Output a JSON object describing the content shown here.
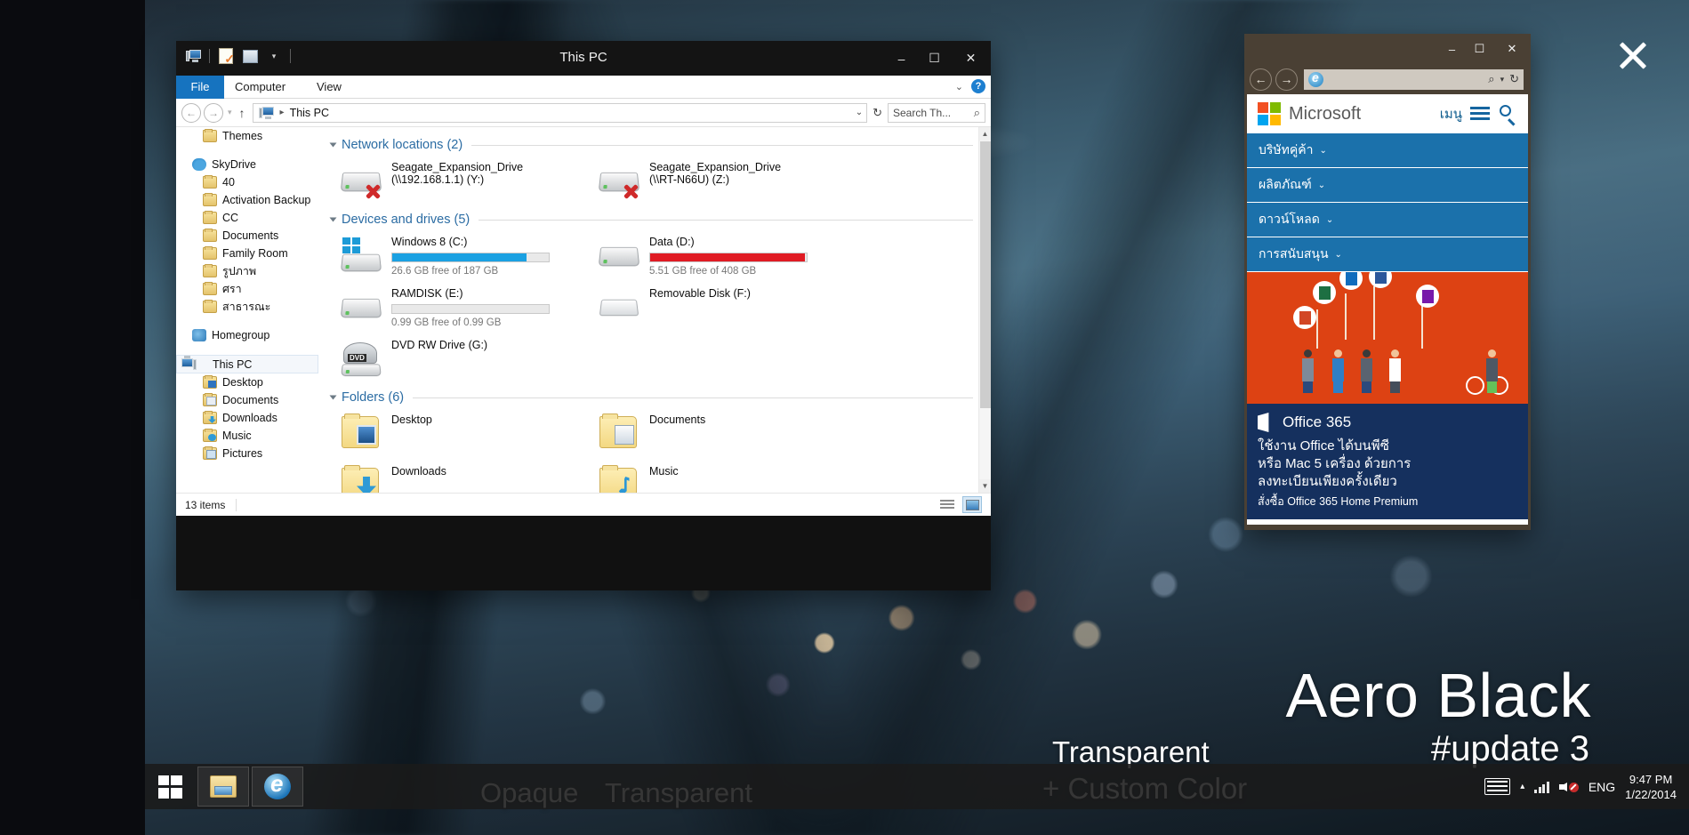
{
  "desktop": {
    "watermarks": {
      "aero": "Aero Black",
      "update": "#update 3",
      "transparent_big": "Transparent",
      "opaque": "Opaque",
      "transparent_small": "Transparent",
      "custom_color": "+ Custom Color"
    },
    "close_icon": "close-icon"
  },
  "explorer": {
    "title": "This PC",
    "quick_access_icons": [
      "this-pc-icon",
      "properties-icon",
      "new-folder-icon",
      "customize-chevron-icon"
    ],
    "window_controls": {
      "minimize": "–",
      "maximize": "☐",
      "close": "✕"
    },
    "ribbon": {
      "file": "File",
      "computer": "Computer",
      "view": "View",
      "collapse": "⌄",
      "help": "?"
    },
    "address": {
      "back": "←",
      "forward": "→",
      "history": "▾",
      "up": "↑",
      "crumb": "This PC",
      "crumb_sep": "▸",
      "dropdown": "⌄",
      "refresh": "↻"
    },
    "search": {
      "placeholder": "Search Th...",
      "icon": "search-icon"
    },
    "tree": [
      {
        "label": "Themes",
        "icon": "folder-icon",
        "indent": true,
        "selected": false
      },
      {
        "spacer": true
      },
      {
        "label": "SkyDrive",
        "icon": "skydrive-icon",
        "indent": false,
        "selected": false
      },
      {
        "label": "40",
        "icon": "folder-icon",
        "indent": true,
        "selected": false
      },
      {
        "label": "Activation Backup",
        "icon": "folder-icon",
        "indent": true,
        "selected": false
      },
      {
        "label": "CC",
        "icon": "folder-icon",
        "indent": true,
        "selected": false
      },
      {
        "label": "Documents",
        "icon": "folder-icon",
        "indent": true,
        "selected": false
      },
      {
        "label": "Family Room",
        "icon": "folder-icon",
        "indent": true,
        "selected": false
      },
      {
        "label": "รูปภาพ",
        "icon": "folder-icon",
        "indent": true,
        "selected": false
      },
      {
        "label": "ศรา",
        "icon": "folder-icon",
        "indent": true,
        "selected": false
      },
      {
        "label": "สาธารณะ",
        "icon": "folder-icon",
        "indent": true,
        "selected": false
      },
      {
        "spacer": true
      },
      {
        "label": "Homegroup",
        "icon": "homegroup-icon",
        "indent": false,
        "selected": false
      },
      {
        "spacer": true
      },
      {
        "label": "This PC",
        "icon": "this-pc-icon",
        "indent": false,
        "selected": true
      },
      {
        "label": "Desktop",
        "icon": "folder-desktop-icon",
        "indent": true,
        "selected": false
      },
      {
        "label": "Documents",
        "icon": "folder-documents-icon",
        "indent": true,
        "selected": false
      },
      {
        "label": "Downloads",
        "icon": "folder-downloads-icon",
        "indent": true,
        "selected": false
      },
      {
        "label": "Music",
        "icon": "folder-music-icon",
        "indent": true,
        "selected": false
      },
      {
        "label": "Pictures",
        "icon": "folder-pictures-icon",
        "indent": true,
        "selected": false
      }
    ],
    "groups": [
      {
        "label": "Network locations (2)",
        "items": [
          {
            "name": "Seagate_Expansion_Drive",
            "name2": "(\\\\192.168.1.1) (Y:)",
            "icon": "network-drive-disconnected-icon"
          },
          {
            "name": "Seagate_Expansion_Drive",
            "name2": "(\\\\RT-N66U) (Z:)",
            "icon": "network-drive-disconnected-icon"
          }
        ]
      },
      {
        "label": "Devices and drives (5)",
        "items": [
          {
            "name": "Windows 8 (C:)",
            "sub": "26.6 GB free of 187 GB",
            "icon": "windows-drive-icon",
            "bar_pct": 86,
            "bar_color": "#1ba1e2"
          },
          {
            "name": "Data (D:)",
            "sub": "5.51 GB free of 408 GB",
            "icon": "hard-drive-icon",
            "bar_pct": 99,
            "bar_color": "#e01b24"
          },
          {
            "name": "RAMDISK (E:)",
            "sub": "0.99 GB free of 0.99 GB",
            "icon": "hard-drive-icon",
            "bar_pct": 0,
            "bar_color": "#bdbdbd"
          },
          {
            "name": "Removable Disk (F:)",
            "sub": "",
            "icon": "removable-disk-icon",
            "bar_pct": null,
            "bar_color": ""
          },
          {
            "name": "DVD RW Drive (G:)",
            "sub": "",
            "icon": "dvd-drive-icon",
            "bar_pct": null,
            "bar_color": ""
          }
        ]
      },
      {
        "label": "Folders (6)",
        "items": [
          {
            "name": "Desktop",
            "icon": "folder-desktop-icon"
          },
          {
            "name": "Documents",
            "icon": "folder-documents-icon"
          },
          {
            "name": "Downloads",
            "icon": "folder-downloads-icon"
          },
          {
            "name": "Music",
            "icon": "folder-music-icon"
          }
        ]
      }
    ],
    "status": {
      "text": "13 items",
      "details_view": "details-view-icon",
      "thumbnail_view": "large-icons-view-icon"
    }
  },
  "ie": {
    "window_controls": {
      "minimize": "–",
      "maximize": "☐",
      "close": "✕"
    },
    "nav": {
      "back": "←",
      "forward": "→",
      "site_icon": "internet-explorer-icon",
      "search": "⌕",
      "dropdown": "▾",
      "refresh": "↻"
    },
    "page": {
      "brand": "Microsoft",
      "menu_label": "เมนู",
      "menu_icon": "hamburger-icon",
      "search_icon": "search-icon",
      "nav_items": [
        {
          "label": "บริษัทคู่ค้า",
          "chevron": "⌄"
        },
        {
          "label": "ผลิตภัณฑ์",
          "chevron": "⌄"
        },
        {
          "label": "ดาวน์โหลด",
          "chevron": "⌄"
        },
        {
          "label": "การสนับสนุน",
          "chevron": "⌄"
        }
      ],
      "hero_alt": "office-people-illustration",
      "office": {
        "logo": "office-365-logo-icon",
        "title": "Office 365",
        "line1": "ใช้งาน Office ได้บนพีซี",
        "line2": "หรือ Mac 5 เครื่อง ด้วยการ",
        "line3": "ลงทะเบียนเพียงครั้งเดียว",
        "sub": "สั่งซื้อ Office 365 Home Premium"
      }
    }
  },
  "taskbar": {
    "start_icon": "windows-start-icon",
    "buttons": [
      {
        "icon": "file-explorer-icon",
        "name": "taskbar-file-explorer"
      },
      {
        "icon": "internet-explorer-icon",
        "name": "taskbar-internet-explorer"
      }
    ],
    "tray": {
      "keyboard_icon": "keyboard-icon",
      "show_hidden": "▴",
      "network_icon": "signal-bars-icon",
      "volume_icon": "volume-muted-icon",
      "language": "ENG",
      "time": "9:47 PM",
      "date": "1/22/2014"
    }
  },
  "colors": {
    "accent_blue": "#1673bf",
    "ms_nav_blue": "#1b71ab",
    "hero_orange": "#dd4213",
    "office_navy": "#15305e",
    "drive_blue": "#1ba1e2",
    "drive_red": "#e01b24"
  }
}
